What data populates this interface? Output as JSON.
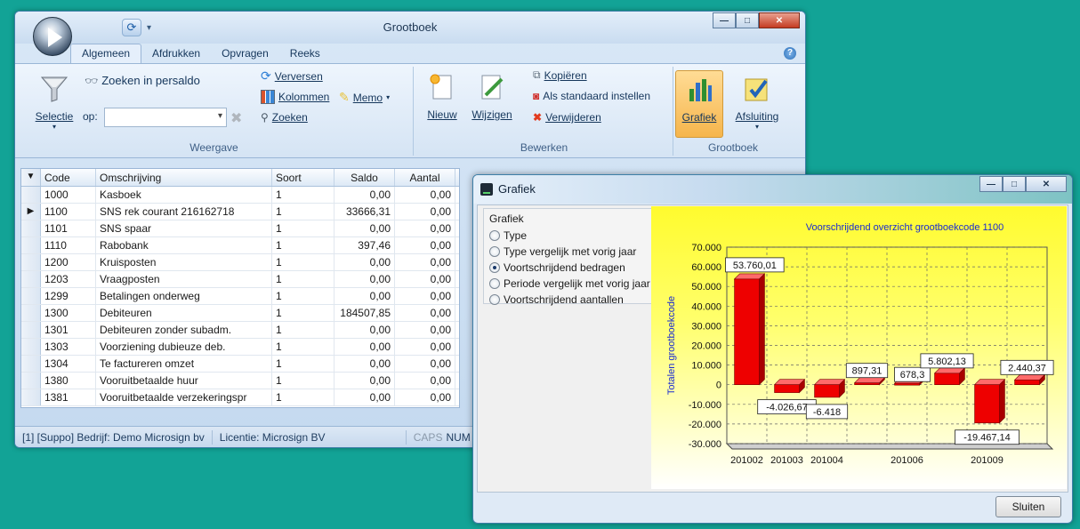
{
  "main": {
    "title": "Grootboek",
    "tabs": [
      "Algemeen",
      "Afdrukken",
      "Opvragen",
      "Reeks"
    ],
    "weergave": {
      "selectie": "Selectie",
      "zoeken_in_persaldo": "Zoeken in persaldo",
      "op_label": "op:",
      "verversen": "Verversen",
      "kolommen": "Kolommen",
      "memo": "Memo",
      "zoeken": "Zoeken",
      "group_label": "Weergave"
    },
    "bewerken": {
      "nieuw": "Nieuw",
      "wijzigen": "Wijzigen",
      "kopieren": "Kopiëren",
      "als_standaard": "Als standaard instellen",
      "verwijderen": "Verwijderen",
      "group_label": "Bewerken"
    },
    "grootboek": {
      "grafiek": "Grafiek",
      "afsluiting": "Afsluiting",
      "group_label": "Grootboek"
    },
    "grid": {
      "headers": [
        "Code",
        "Omschrijving",
        "Soort",
        "Saldo",
        "Aantal"
      ],
      "rows": [
        {
          "code": "1000",
          "desc": "Kasboek",
          "soort": "1",
          "saldo": "0,00",
          "aantal": "0,00"
        },
        {
          "code": "1100",
          "desc": "SNS rek courant 216162718",
          "soort": "1",
          "saldo": "33666,31",
          "aantal": "0,00"
        },
        {
          "code": "1101",
          "desc": "SNS spaar",
          "soort": "1",
          "saldo": "0,00",
          "aantal": "0,00"
        },
        {
          "code": "1110",
          "desc": "Rabobank",
          "soort": "1",
          "saldo": "397,46",
          "aantal": "0,00"
        },
        {
          "code": "1200",
          "desc": "Kruisposten",
          "soort": "1",
          "saldo": "0,00",
          "aantal": "0,00"
        },
        {
          "code": "1203",
          "desc": "Vraagposten",
          "soort": "1",
          "saldo": "0,00",
          "aantal": "0,00"
        },
        {
          "code": "1299",
          "desc": "Betalingen onderweg",
          "soort": "1",
          "saldo": "0,00",
          "aantal": "0,00"
        },
        {
          "code": "1300",
          "desc": "Debiteuren",
          "soort": "1",
          "saldo": "184507,85",
          "aantal": "0,00"
        },
        {
          "code": "1301",
          "desc": "Debiteuren zonder subadm.",
          "soort": "1",
          "saldo": "0,00",
          "aantal": "0,00"
        },
        {
          "code": "1303",
          "desc": "Voorziening dubieuze deb.",
          "soort": "1",
          "saldo": "0,00",
          "aantal": "0,00"
        },
        {
          "code": "1304",
          "desc": "Te factureren omzet",
          "soort": "1",
          "saldo": "0,00",
          "aantal": "0,00"
        },
        {
          "code": "1380",
          "desc": "Vooruitbetaalde huur",
          "soort": "1",
          "saldo": "0,00",
          "aantal": "0,00"
        },
        {
          "code": "1381",
          "desc": "Vooruitbetaalde verzekeringspr",
          "soort": "1",
          "saldo": "0,00",
          "aantal": "0,00"
        }
      ],
      "selected_row": 1
    },
    "status": {
      "company": "[1] [Suppo] Bedrijf: Demo Microsign bv",
      "license": "Licentie: Microsign BV",
      "caps": "CAPS",
      "num": "NUM"
    }
  },
  "dialog": {
    "title": "Grafiek",
    "group_title": "Grafiek",
    "options": [
      {
        "label": "Type",
        "checked": false
      },
      {
        "label": "Type vergelijk met vorig jaar",
        "checked": false
      },
      {
        "label": "Voortschrijdend bedragen",
        "checked": true
      },
      {
        "label": "Periode vergelijk met vorig jaar",
        "checked": false
      },
      {
        "label": "Voortschrijdend aantallen",
        "checked": false
      }
    ],
    "close_button": "Sluiten"
  },
  "chart_data": {
    "type": "bar",
    "title": "Voorschrijdend overzicht grootboekcode 1100",
    "ylabel": "Totalen grootboekcode",
    "xlabel": "",
    "ylim": [
      -30000,
      70000
    ],
    "yticks": [
      "70.000",
      "60.000",
      "50.000",
      "40.000",
      "30.000",
      "20.000",
      "10.000",
      "0",
      "-10.000",
      "-20.000",
      "-30.000"
    ],
    "ytick_values": [
      70000,
      60000,
      50000,
      40000,
      30000,
      20000,
      10000,
      0,
      -10000,
      -20000,
      -30000
    ],
    "values": [
      53760.01,
      -4026.67,
      -6418,
      897.31,
      678.3,
      5802.13,
      -19467.14,
      2440.37
    ],
    "value_labels": [
      "53.760,01",
      "-4.026,67",
      "-6.418",
      "897,31",
      "678,3",
      "5.802,13",
      "-19.467,14",
      "2.440,37"
    ],
    "x_tick_labels": [
      {
        "index": 0,
        "label": "201002"
      },
      {
        "index": 1,
        "label": "201003"
      },
      {
        "index": 2,
        "label": "201004"
      },
      {
        "index": 4,
        "label": "201006"
      },
      {
        "index": 6,
        "label": "201009"
      }
    ],
    "bar_color": "#ee0000",
    "grid": true
  }
}
